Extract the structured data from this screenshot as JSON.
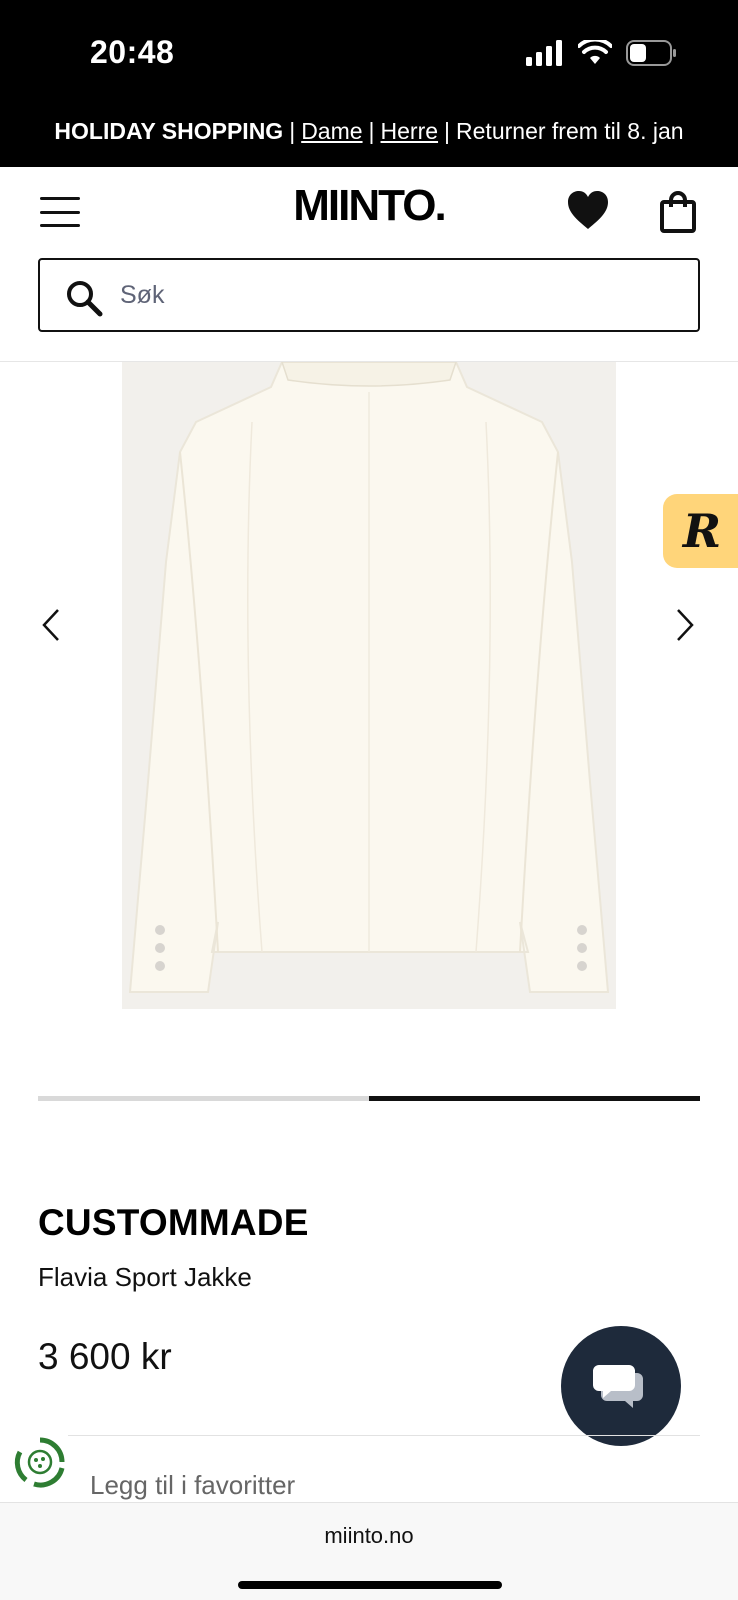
{
  "status_bar": {
    "time": "20:48",
    "icons": [
      "signal-icon",
      "wifi-icon",
      "battery-icon"
    ]
  },
  "promo": {
    "holiday": "HOLIDAY SHOPPING",
    "separator": "|",
    "dame": "Dame",
    "herre": "Herre",
    "returns": "Returner frem til 8. jan"
  },
  "header": {
    "logo": "MIINTO.",
    "search_placeholder": "Søk",
    "icons": [
      "menu-icon",
      "heart-icon",
      "shopping-bag-icon",
      "search-icon"
    ]
  },
  "gallery": {
    "badge": "R",
    "progress_fraction": 0.5,
    "current_index": 2,
    "total_images": 2,
    "icons": [
      "chevron-left-icon",
      "chevron-right-icon"
    ]
  },
  "product": {
    "brand": "CUSTOMMADE",
    "name": "Flavia Sport Jakke",
    "price": "3 600 kr",
    "favorite": "Legg til i favoritter"
  },
  "browser": {
    "url": "miinto.no"
  },
  "colors": {
    "accent_badge": "#ffd57a",
    "chat_button": "#1e2a3b",
    "eco_green": "#2e7d32"
  }
}
